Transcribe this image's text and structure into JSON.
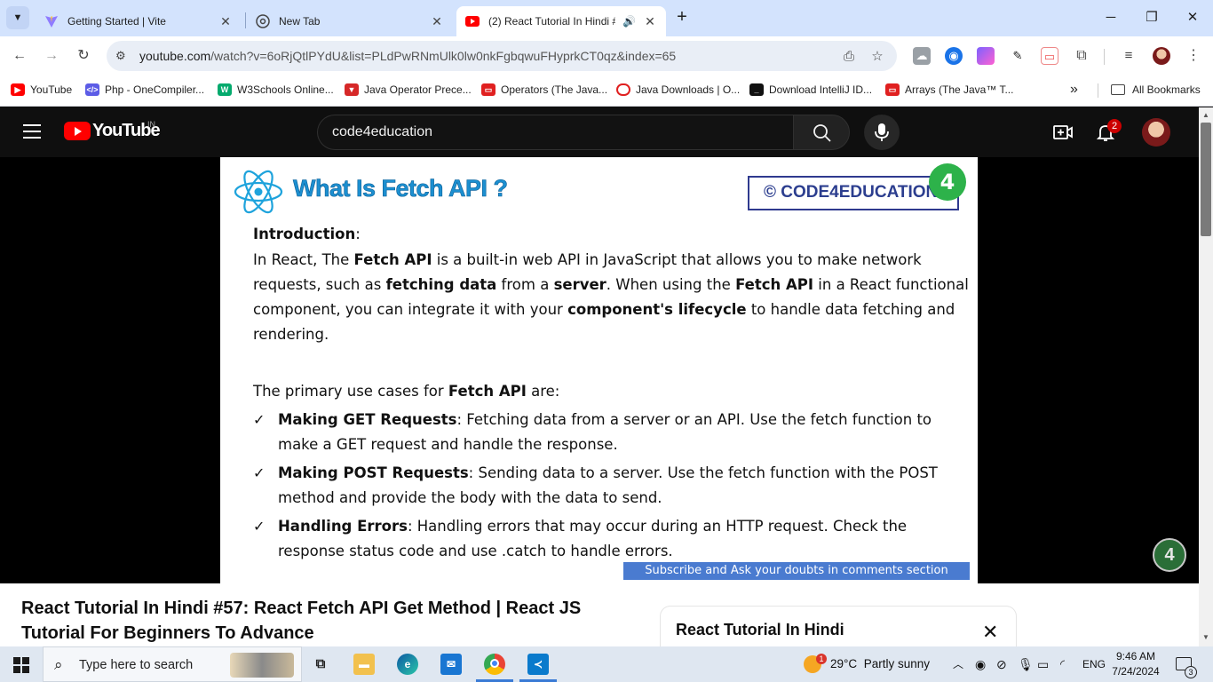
{
  "browser": {
    "tabs": [
      {
        "title": "Getting Started | Vite",
        "icon": "vite-icon",
        "active": false
      },
      {
        "title": "New Tab",
        "icon": "chrome-icon",
        "active": false
      },
      {
        "title": "(2) React Tutorial In Hindi #",
        "icon": "youtube-icon",
        "active": true
      }
    ],
    "url_domain": "youtube.com",
    "url_rest": "/watch?v=6oRjQtlPYdU&list=PLdPwRNmUlk0lw0nkFgbqwuFHyprkCT0qz&index=65",
    "bookmarks": [
      {
        "label": "YouTube",
        "color": "#ff0000"
      },
      {
        "label": "Php - OneCompiler...",
        "color": "#5c5ce6"
      },
      {
        "label": "W3Schools Online...",
        "color": "#04aa6d"
      },
      {
        "label": "Java Operator Prece...",
        "color": "#d62828"
      },
      {
        "label": "Operators (The Java...",
        "color": "#e02020"
      },
      {
        "label": "Java Downloads | O...",
        "color": "#e02020"
      },
      {
        "label": "Download IntelliJ ID...",
        "color": "#111111"
      },
      {
        "label": "Arrays (The Java™ T...",
        "color": "#e02020"
      }
    ],
    "all_bookmarks": "All Bookmarks"
  },
  "youtube": {
    "logo_text": "YouTube",
    "country_code": "IN",
    "search_value": "code4education",
    "notification_count": "2",
    "video_title": "React Tutorial In Hindi #57: React Fetch API Get Method | React JS Tutorial For Beginners To Advance",
    "playlist_title": "React Tutorial In Hindi"
  },
  "slide": {
    "heading": "What Is Fetch API ?",
    "brand": "© CODE4EDUCATION",
    "brand_badge": "4",
    "intro_label": "Introduction",
    "intro_lines": [
      [
        "In React, The ",
        "Fetch API",
        " is a built-in web API in JavaScript that allows you to make network"
      ],
      [
        "requests, such as ",
        "fetching data",
        " from a ",
        "server",
        ". When using the ",
        "Fetch API",
        " in a React functional"
      ],
      [
        "component, you can integrate it with your ",
        "component's lifecycle",
        " to handle data fetching and"
      ],
      [
        "rendering."
      ]
    ],
    "uses_intro": [
      "The primary use cases for ",
      "Fetch API",
      " are:"
    ],
    "check_mark": "✓",
    "uses": [
      {
        "term": "Making GET Requests",
        "line1": ": Fetching data from a server or an API. Use the fetch function to",
        "line2": "make a GET request and handle the response."
      },
      {
        "term": "Making POST Requests",
        "line1": ": Sending data to a server. Use the fetch function with the POST",
        "line2": "method and provide the body with the data to send."
      },
      {
        "term": "Handling Errors",
        "line1": ": Handling errors that may occur during an HTTP request. Check the",
        "line2": "response status code and use .catch to handle errors."
      }
    ],
    "subscribe_text": "Subscribe and Ask your doubts in comments section"
  },
  "taskbar": {
    "search_placeholder": "Type here to search",
    "temperature": "29°C",
    "weather": "Partly sunny",
    "language": "ENG",
    "time": "9:46 AM",
    "date": "7/24/2024",
    "notification_count": "3",
    "weather_badge": "1"
  }
}
